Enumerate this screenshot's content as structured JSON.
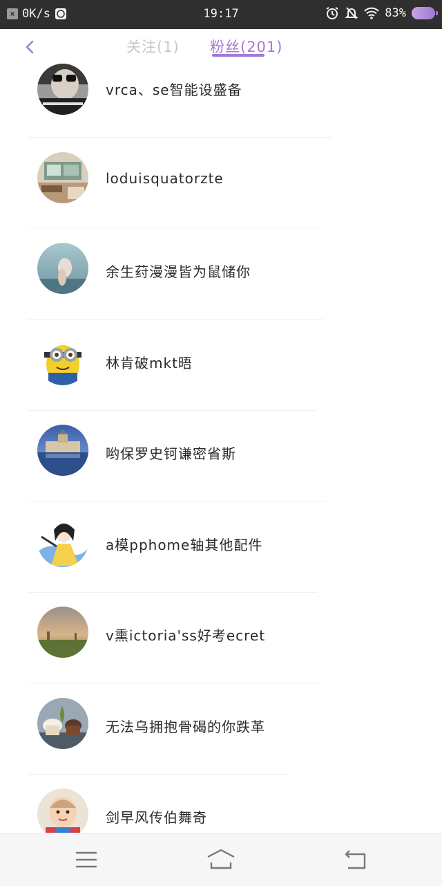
{
  "status_bar": {
    "net_speed": "0K/s",
    "time": "19:17",
    "battery": "83%",
    "icons": [
      "close-icon",
      "browser-icon",
      "alarm-icon",
      "bell-off-icon",
      "wifi-icon",
      "battery-icon"
    ]
  },
  "header": {
    "tabs": [
      {
        "label": "关注(1)",
        "active": false
      },
      {
        "label": "粉丝(201)",
        "active": true
      }
    ],
    "accent_color": "#a07ad6"
  },
  "followers": [
    {
      "name": "vrca、se智能设盛备",
      "avatar": "avatar-photo-sunglasses-man"
    },
    {
      "name": "loduisquatorzte",
      "avatar": "avatar-photo-cafe-interior"
    },
    {
      "name": "余生荮漫漫皆为鼠储你",
      "avatar": "avatar-photo-hand-sky"
    },
    {
      "name": "林肯破mkt晤",
      "avatar": "avatar-minion-cartoon"
    },
    {
      "name": "哟保罗史钶谦密省斯",
      "avatar": "avatar-photo-castle-lake"
    },
    {
      "name": "a模pphome轴其他配件",
      "avatar": "avatar-illustration-girl"
    },
    {
      "name": "v熏ictoria'ss好考ecret",
      "avatar": "avatar-photo-foggy-field"
    },
    {
      "name": "无法乌拥抱骨碣的你跌革",
      "avatar": "avatar-photo-cupcakes"
    },
    {
      "name": "剑早风传伯舞奇",
      "avatar": "avatar-photo-baby"
    }
  ],
  "navbar": {
    "buttons": [
      "menu-icon",
      "home-icon",
      "back-icon"
    ]
  }
}
